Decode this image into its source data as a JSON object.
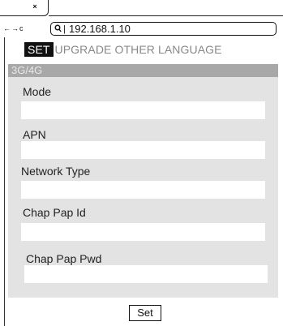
{
  "browser": {
    "tab_close": "×",
    "back": "←",
    "forward": "→",
    "reload": "c",
    "url": "192.168.1.10",
    "url_separator": "|"
  },
  "menu": {
    "items": [
      {
        "label": "SET",
        "active": true
      },
      {
        "label": "UPGRADE",
        "active": false
      },
      {
        "label": "OTHER",
        "active": false
      },
      {
        "label": "LANGUAGE",
        "active": false
      }
    ]
  },
  "panel": {
    "title": "3G/4G",
    "fields": [
      {
        "label": "Mode",
        "value": ""
      },
      {
        "label": "APN",
        "value": ""
      },
      {
        "label": "Network Type",
        "value": ""
      },
      {
        "label": "Chap Pap Id",
        "value": ""
      },
      {
        "label": "Chap Pap Pwd",
        "value": ""
      }
    ]
  },
  "actions": {
    "set_label": "Set"
  },
  "colors": {
    "panel_bg": "#e3e3e3",
    "panel_header_bg": "#a8a8a8",
    "active_menu_bg": "#111111",
    "inactive_menu_text": "#888888"
  }
}
